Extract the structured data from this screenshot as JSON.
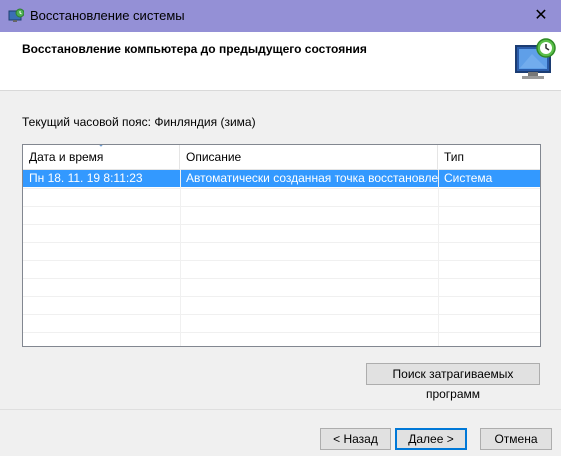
{
  "window": {
    "title": "Восстановление системы",
    "close_glyph": "✕"
  },
  "header": {
    "heading": "Восстановление компьютера до предыдущего состояния"
  },
  "timezone_text": "Текущий часовой пояс: Финляндия (зима)",
  "table": {
    "columns": [
      "Дата и время",
      "Описание",
      "Тип"
    ],
    "rows": [
      {
        "date": "Пн 18. 11. 19 8:11:23",
        "description": "Автоматически созданная точка восстановле...",
        "type": "Система",
        "selected": true
      }
    ]
  },
  "buttons": {
    "search": "Поиск затрагиваемых программ",
    "back": "< Назад",
    "next": "Далее >",
    "cancel": "Отмена"
  },
  "colors": {
    "titlebar": "#9490d6",
    "selection": "#3399ff",
    "default_button_border": "#0078d7"
  },
  "icons": {
    "app": "system-restore-icon",
    "header": "monitor-restore-icon",
    "close": "close-icon"
  }
}
